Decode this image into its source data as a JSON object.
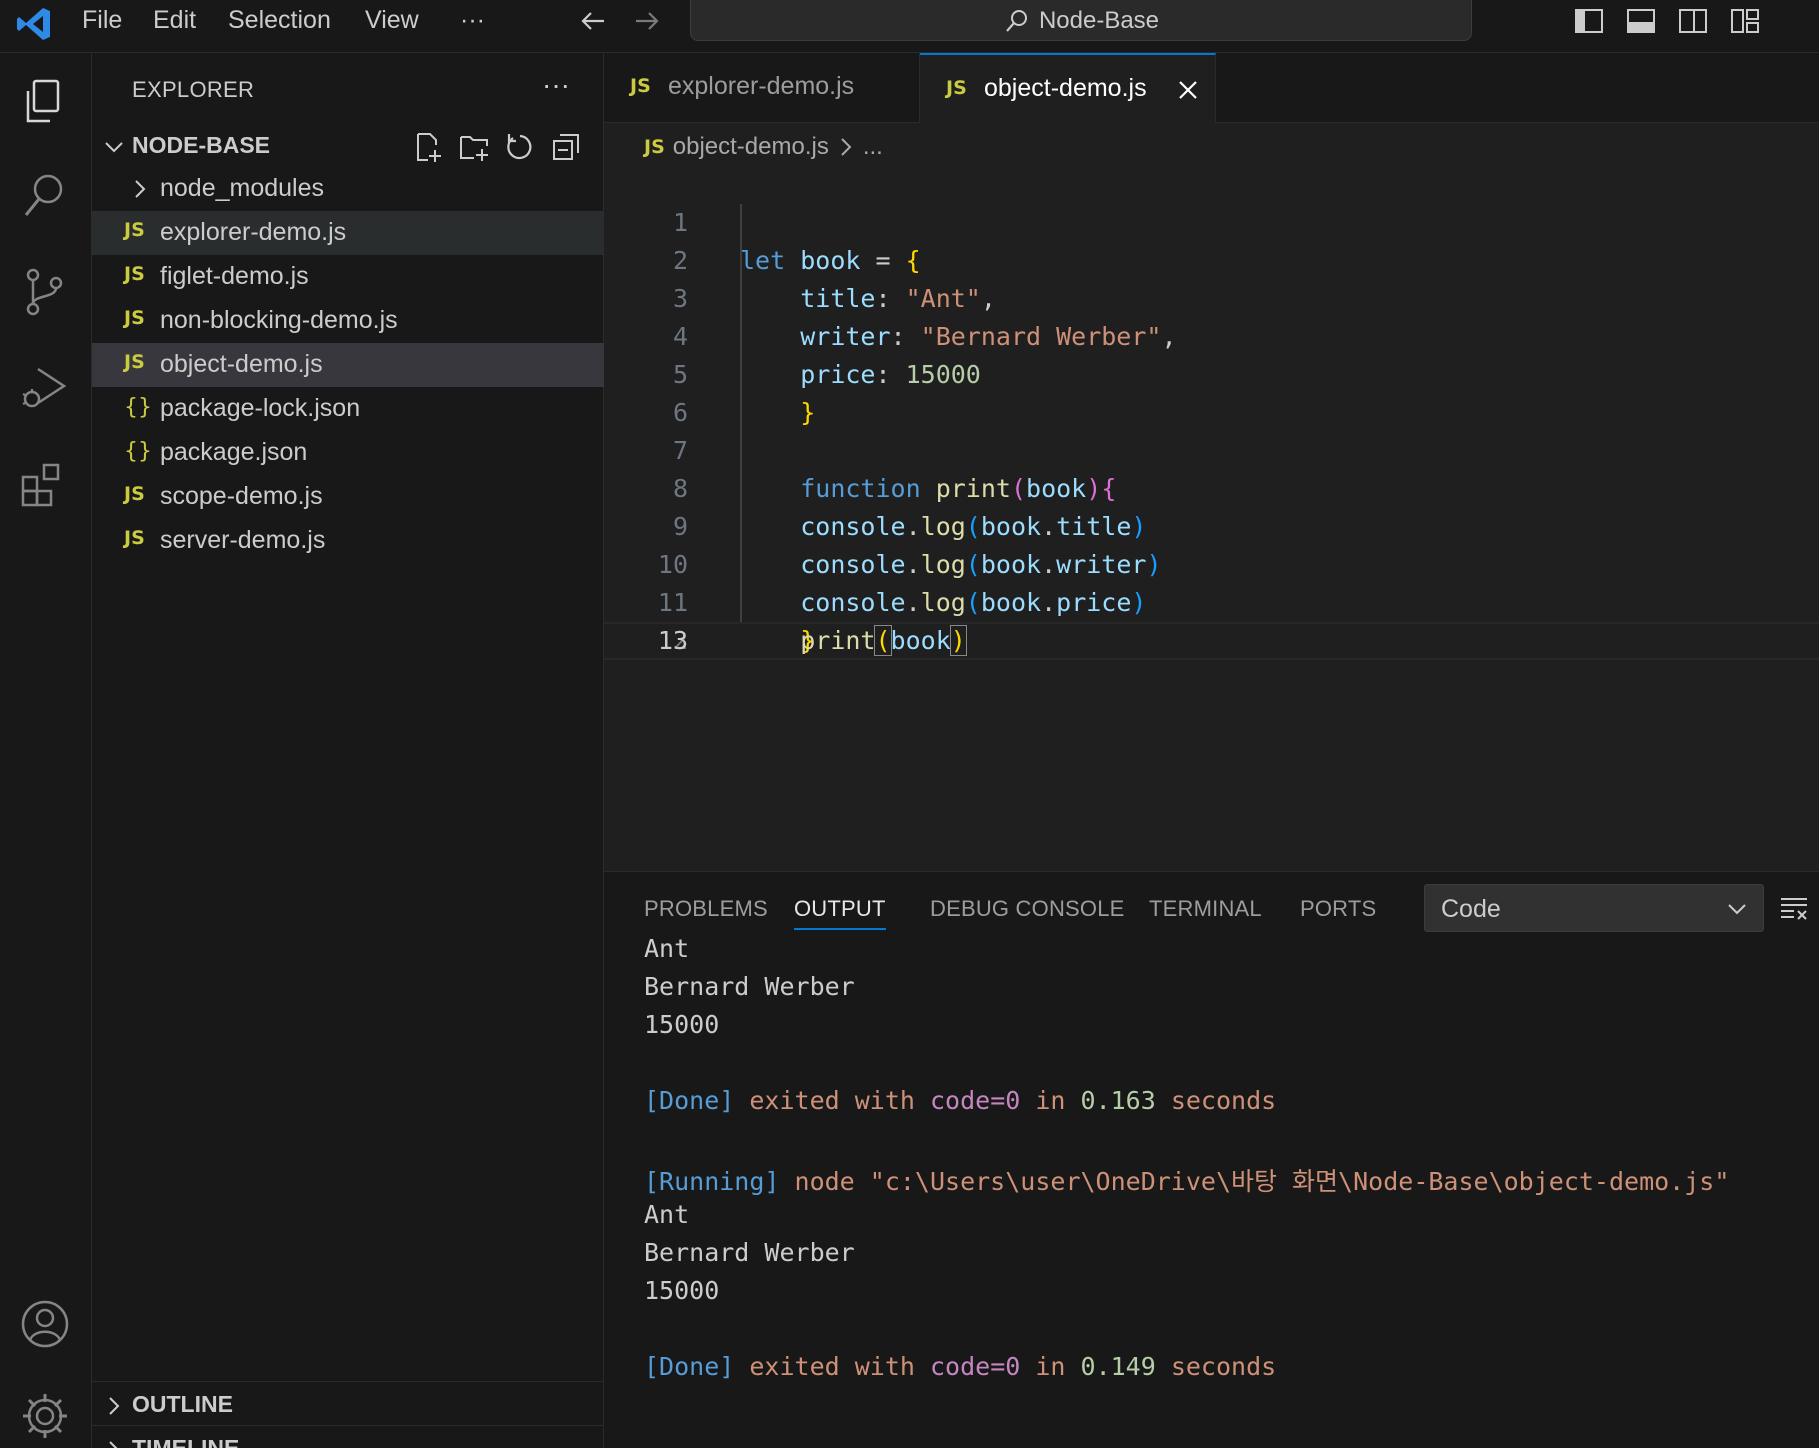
{
  "titlebar": {
    "menus": [
      "File",
      "Edit",
      "Selection",
      "View",
      "···"
    ],
    "search_label": "Node-Base"
  },
  "sidebar": {
    "title": "EXPLORER",
    "more": "···",
    "project": "NODE-BASE",
    "tree": [
      {
        "label": "node_modules",
        "kind": "folder"
      },
      {
        "label": "explorer-demo.js",
        "kind": "js"
      },
      {
        "label": "figlet-demo.js",
        "kind": "js"
      },
      {
        "label": "non-blocking-demo.js",
        "kind": "js"
      },
      {
        "label": "object-demo.js",
        "kind": "js"
      },
      {
        "label": "package-lock.json",
        "kind": "json"
      },
      {
        "label": "package.json",
        "kind": "json"
      },
      {
        "label": "scope-demo.js",
        "kind": "js"
      },
      {
        "label": "server-demo.js",
        "kind": "js"
      }
    ],
    "js_badge": "JS",
    "json_badge": "{}",
    "outline": "OUTLINE",
    "timeline": "TIMELINE"
  },
  "editor": {
    "tabs": [
      {
        "label": "explorer-demo.js",
        "badge": "JS"
      },
      {
        "label": "object-demo.js",
        "badge": "JS"
      }
    ],
    "breadcrumb": {
      "badge": "JS",
      "file": "object-demo.js",
      "rest": "..."
    },
    "line_numbers": [
      "1",
      "2",
      "3",
      "4",
      "5",
      "6",
      "7",
      "8",
      "9",
      "10",
      "11",
      "12",
      "13"
    ],
    "code": {
      "l1": {
        "kw": "let",
        "name": "book",
        "op": " = ",
        "brace": "{"
      },
      "l2": {
        "key": "title",
        "colon": ": ",
        "val": "\"Ant\"",
        "comma": ","
      },
      "l3": {
        "key": "writer",
        "colon": ": ",
        "val": "\"Bernard Werber\"",
        "comma": ","
      },
      "l4": {
        "key": "price",
        "colon": ": ",
        "val": "15000"
      },
      "l5": {
        "brace": "}"
      },
      "l7": {
        "kw": "function",
        "fn": "print",
        "p_open": "(",
        "arg": "book",
        "p_close": ")",
        "brace": "{"
      },
      "l8": {
        "obj": "console",
        "dot": ".",
        "fn": "log",
        "p_open": "(",
        "arg": "book",
        "dot2": ".",
        "prop": "title",
        "p_close": ")"
      },
      "l9": {
        "obj": "console",
        "dot": ".",
        "fn": "log",
        "p_open": "(",
        "arg": "book",
        "dot2": ".",
        "prop": "writer",
        "p_close": ")"
      },
      "l10": {
        "obj": "console",
        "dot": ".",
        "fn": "log",
        "p_open": "(",
        "arg": "book",
        "dot2": ".",
        "prop": "price",
        "p_close": ")"
      },
      "l11": {
        "brace": "}"
      },
      "l13": {
        "fn": "print",
        "p_open": "(",
        "arg": "book",
        "p_close": ")"
      }
    }
  },
  "panel": {
    "tabs": [
      "PROBLEMS",
      "OUTPUT",
      "DEBUG CONSOLE",
      "TERMINAL",
      "PORTS"
    ],
    "active_tab": "OUTPUT",
    "channel": "Code",
    "output": {
      "o1": "Ant",
      "o2": "Bernard Werber",
      "o3": "15000",
      "done1": {
        "tag": "[Done]",
        "a": " exited with ",
        "b": "code=0",
        "c": " in ",
        "d": "0.163",
        "e": " seconds"
      },
      "running": {
        "tag": "[Running]",
        "a": " node \"c:\\Users\\user\\OneDrive\\바탕 화면\\Node-Base\\object-demo.js\""
      },
      "o4": "Ant",
      "o5": "Bernard Werber",
      "o6": "15000",
      "done2": {
        "tag": "[Done]",
        "a": " exited with ",
        "b": "code=0",
        "c": " in ",
        "d": "0.149",
        "e": " seconds"
      }
    }
  },
  "colors": {
    "accent": "#0078d4",
    "js_badge": "#cbcb41",
    "bg": "#1f1f1f",
    "sidebar_bg": "#181818"
  }
}
